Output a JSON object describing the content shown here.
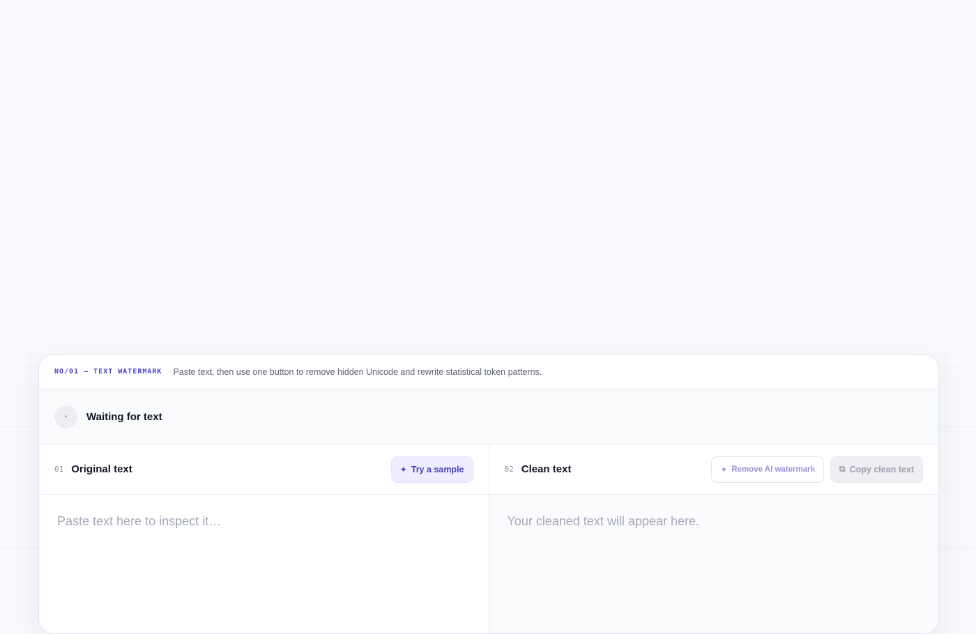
{
  "header": {
    "eyebrow": "NO/01 — TEXT WATERMARK",
    "description": "Paste text, then use one button to remove hidden Unicode and rewrite statistical token patterns."
  },
  "status": {
    "icon": "dot-icon",
    "text": "Waiting for text"
  },
  "original": {
    "number": "01",
    "title": "Original text",
    "sample_button": "Try a sample",
    "sample_icon": "✦",
    "placeholder": "Paste text here to inspect it…"
  },
  "clean": {
    "number": "02",
    "title": "Clean text",
    "remove_button": "Remove AI watermark",
    "remove_icon": "✦",
    "copy_button": "Copy clean text",
    "copy_icon": "⧉",
    "placeholder": "Your cleaned text will appear here."
  },
  "colors": {
    "accent": "#4b3fc8",
    "background": "#f8f9fc"
  }
}
